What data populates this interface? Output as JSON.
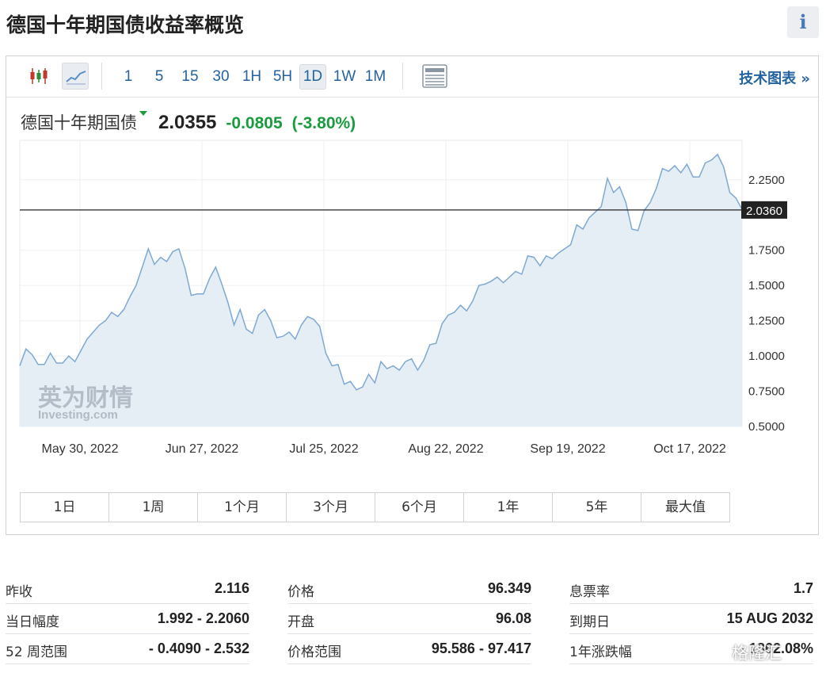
{
  "header": {
    "title": "德国十年期国债收益率概览",
    "info_icon": "i"
  },
  "toolbar": {
    "timeframes": [
      "1",
      "5",
      "15",
      "30",
      "1H",
      "5H",
      "1D",
      "1W",
      "1M"
    ],
    "active_timeframe": "1D",
    "tech_chart_link": "技术图表 »"
  },
  "quote": {
    "name": "德国十年期国债",
    "price": "2.0355",
    "change": "-0.0805",
    "change_pct": "(-3.80%)",
    "change_color": "#1a9c3e"
  },
  "chart_data": {
    "type": "area",
    "title": "",
    "xlabel": "",
    "ylabel": "",
    "ylim": [
      0.5,
      2.53
    ],
    "yticks": [
      "2.2500",
      "1.7500",
      "1.5000",
      "1.2500",
      "1.0000",
      "0.7500",
      "0.5000"
    ],
    "xticks": [
      "May 30, 2022",
      "Jun 27, 2022",
      "Jul 25, 2022",
      "Aug 22, 2022",
      "Sep 19, 2022",
      "Oct 17, 2022"
    ],
    "current_value_label": "2.0360",
    "current_value": 2.036,
    "series": [
      {
        "values": [
          0.93,
          1.05,
          1.01,
          0.94,
          0.94,
          1.02,
          0.95,
          0.95,
          1.0,
          0.96,
          1.04,
          1.12,
          1.17,
          1.22,
          1.25,
          1.31,
          1.28,
          1.33,
          1.42,
          1.5,
          1.63,
          1.76,
          1.65,
          1.7,
          1.67,
          1.74,
          1.76,
          1.62,
          1.43,
          1.44,
          1.44,
          1.55,
          1.63,
          1.51,
          1.38,
          1.22,
          1.33,
          1.19,
          1.16,
          1.29,
          1.33,
          1.25,
          1.13,
          1.14,
          1.17,
          1.12,
          1.22,
          1.28,
          1.26,
          1.21,
          1.02,
          0.93,
          0.94,
          0.8,
          0.82,
          0.76,
          0.78,
          0.87,
          0.81,
          0.96,
          0.91,
          0.93,
          0.9,
          0.96,
          0.98,
          0.9,
          0.97,
          1.08,
          1.09,
          1.23,
          1.29,
          1.31,
          1.36,
          1.32,
          1.39,
          1.5,
          1.51,
          1.53,
          1.56,
          1.52,
          1.56,
          1.6,
          1.58,
          1.71,
          1.7,
          1.64,
          1.71,
          1.69,
          1.73,
          1.76,
          1.79,
          1.93,
          1.9,
          1.98,
          2.02,
          2.06,
          2.26,
          2.16,
          2.2,
          2.09,
          1.9,
          1.89,
          2.03,
          2.09,
          2.19,
          2.33,
          2.31,
          2.35,
          2.3,
          2.36,
          2.27,
          2.27,
          2.37,
          2.39,
          2.43,
          2.34,
          2.16,
          2.12,
          2.04
        ]
      }
    ],
    "fill_color": "#e5edf5",
    "line_color": "#7fa9d3",
    "watermark_cn": "英为财情",
    "watermark_en": "Investing.com"
  },
  "ranges": [
    "1日",
    "1周",
    "1个月",
    "3个月",
    "6个月",
    "1年",
    "5年",
    "最大值"
  ],
  "stats": {
    "col1": [
      {
        "label": "昨收",
        "value": "2.116"
      },
      {
        "label": "当日幅度",
        "value": "1.992 - 2.2060"
      },
      {
        "label": "52 周范围",
        "value": "- 0.4090 - 2.532"
      }
    ],
    "col2": [
      {
        "label": "价格",
        "value": "96.349"
      },
      {
        "label": "开盘",
        "value": "96.08"
      },
      {
        "label": "价格范围",
        "value": "95.586 - 97.417"
      }
    ],
    "col3": [
      {
        "label": "息票率",
        "value": "1.7"
      },
      {
        "label": "到期日",
        "value": "15 AUG 2032"
      },
      {
        "label": "1年涨跌幅",
        "value": "- 1862.08%"
      }
    ]
  },
  "watermark_bottom": "格隆汇"
}
